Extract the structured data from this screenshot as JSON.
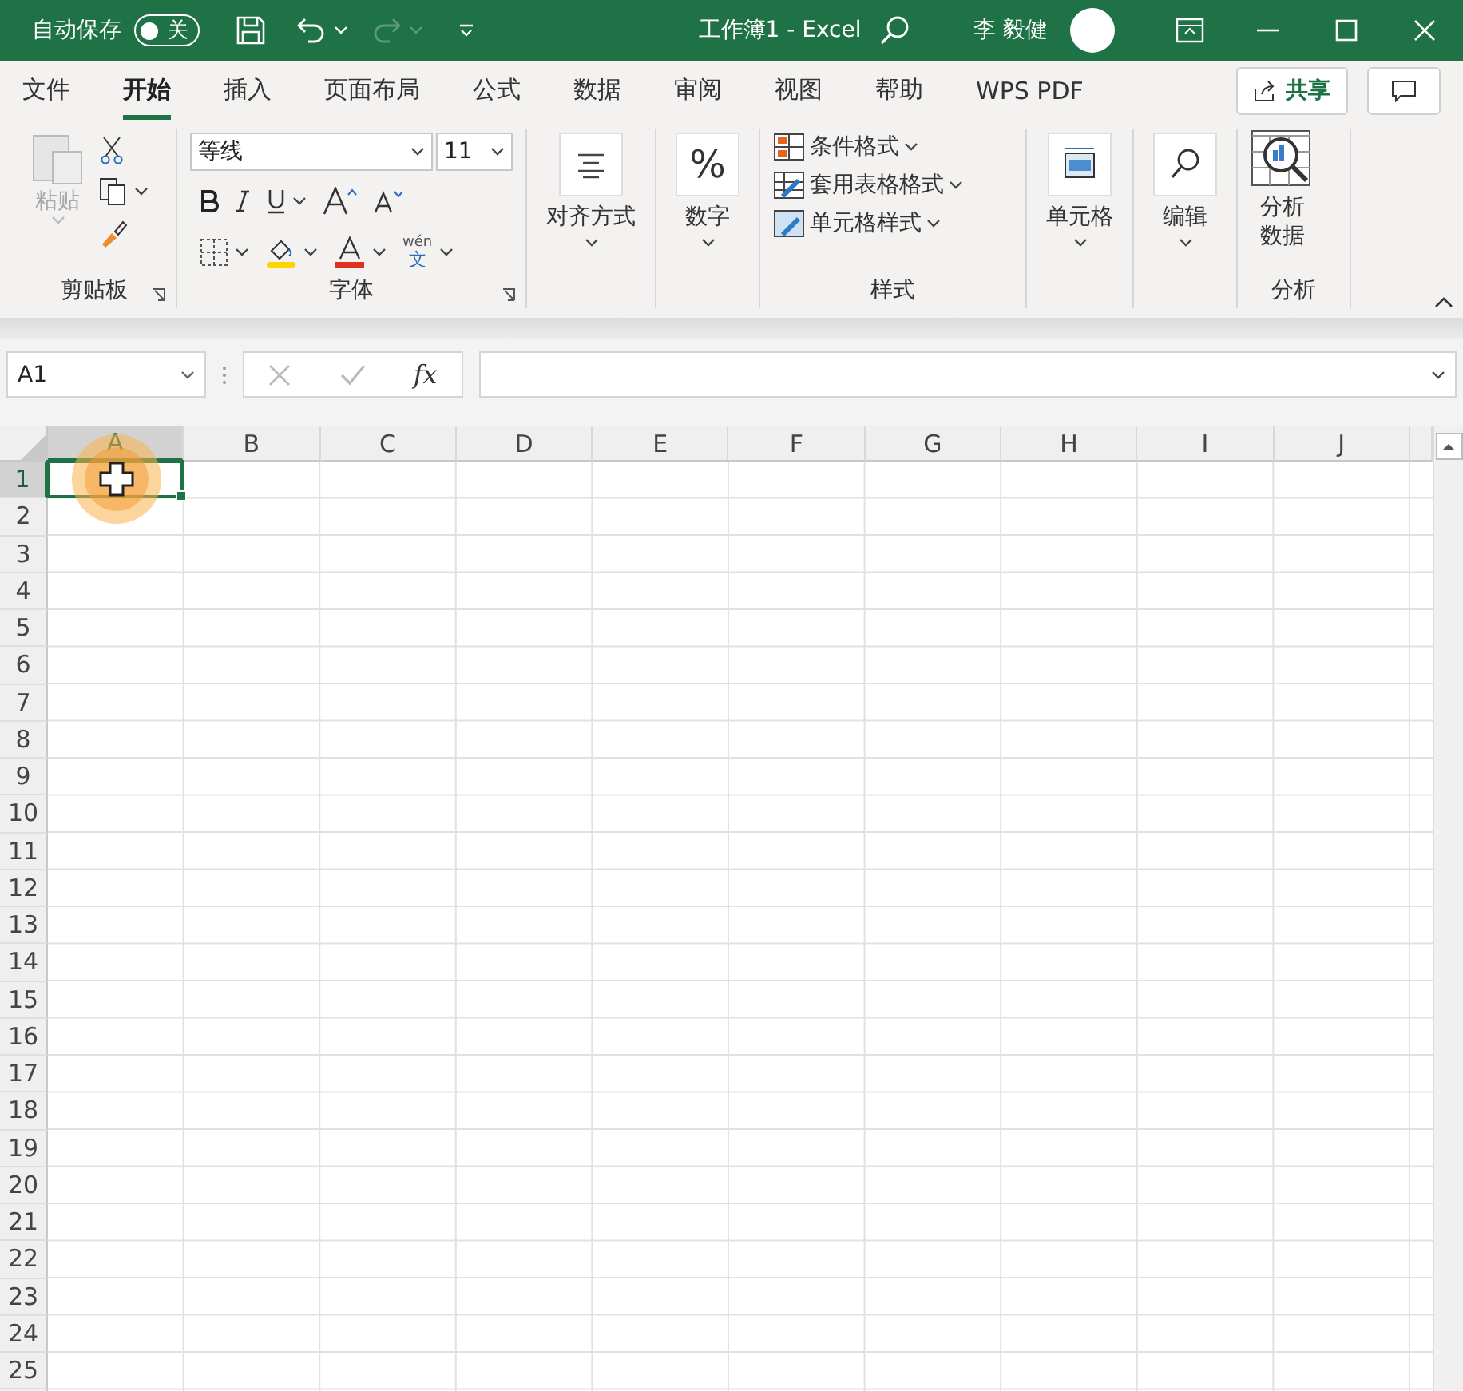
{
  "title_bar": {
    "autosave_label": "自动保存",
    "autosave": {
      "on": false,
      "label": "关"
    },
    "title": "工作簿1  -  Excel",
    "user": "李 毅健"
  },
  "tabs": [
    {
      "label": "文件",
      "selected": false
    },
    {
      "label": "开始",
      "selected": true
    },
    {
      "label": "插入",
      "selected": false
    },
    {
      "label": "页面布局",
      "selected": false
    },
    {
      "label": "公式",
      "selected": false
    },
    {
      "label": "数据",
      "selected": false
    },
    {
      "label": "审阅",
      "selected": false
    },
    {
      "label": "视图",
      "selected": false
    },
    {
      "label": "帮助",
      "selected": false
    },
    {
      "label": "WPS PDF",
      "selected": false
    }
  ],
  "share_button": "共享",
  "ribbon": {
    "groups": [
      {
        "kind": "clipboard",
        "label": "剪贴板",
        "paste": {
          "label": "粘贴",
          "disabled": true
        }
      },
      {
        "kind": "font",
        "label": "字体",
        "font_name": "等线",
        "font_size": "11",
        "phonetic_top": "wén",
        "phonetic_bottom": "文"
      },
      {
        "kind": "alignment",
        "label": "对齐方式"
      },
      {
        "kind": "number",
        "label": "数字",
        "icon_text": "%"
      },
      {
        "kind": "styles",
        "label": "样式",
        "items": [
          {
            "label": "条件格式"
          },
          {
            "label": "套用表格格式"
          },
          {
            "label": "单元格样式"
          }
        ]
      },
      {
        "kind": "cells",
        "label": "单元格"
      },
      {
        "kind": "editing",
        "label": "编辑"
      },
      {
        "kind": "analysis",
        "label": "分析",
        "button": "分析数据"
      }
    ]
  },
  "formula_bar": {
    "name_box": "A1",
    "fx": "fx"
  },
  "sheet": {
    "columns": [
      {
        "label": "A",
        "selected": true
      },
      {
        "label": "B",
        "selected": false
      },
      {
        "label": "C",
        "selected": false
      },
      {
        "label": "D",
        "selected": false
      },
      {
        "label": "E",
        "selected": false
      },
      {
        "label": "F",
        "selected": false
      },
      {
        "label": "G",
        "selected": false
      },
      {
        "label": "H",
        "selected": false
      },
      {
        "label": "I",
        "selected": false
      },
      {
        "label": "J",
        "selected": false
      }
    ],
    "rows": [
      {
        "label": "1",
        "selected": true
      },
      {
        "label": "2",
        "selected": false
      },
      {
        "label": "3",
        "selected": false
      },
      {
        "label": "4",
        "selected": false
      },
      {
        "label": "5",
        "selected": false
      },
      {
        "label": "6",
        "selected": false
      },
      {
        "label": "7",
        "selected": false
      },
      {
        "label": "8",
        "selected": false
      },
      {
        "label": "9",
        "selected": false
      },
      {
        "label": "10",
        "selected": false
      },
      {
        "label": "11",
        "selected": false
      },
      {
        "label": "12",
        "selected": false
      },
      {
        "label": "13",
        "selected": false
      },
      {
        "label": "14",
        "selected": false
      },
      {
        "label": "15",
        "selected": false
      },
      {
        "label": "16",
        "selected": false
      },
      {
        "label": "17",
        "selected": false
      },
      {
        "label": "18",
        "selected": false
      },
      {
        "label": "19",
        "selected": false
      },
      {
        "label": "20",
        "selected": false
      },
      {
        "label": "21",
        "selected": false
      },
      {
        "label": "22",
        "selected": false
      },
      {
        "label": "23",
        "selected": false
      },
      {
        "label": "24",
        "selected": false
      },
      {
        "label": "25",
        "selected": false
      }
    ]
  }
}
